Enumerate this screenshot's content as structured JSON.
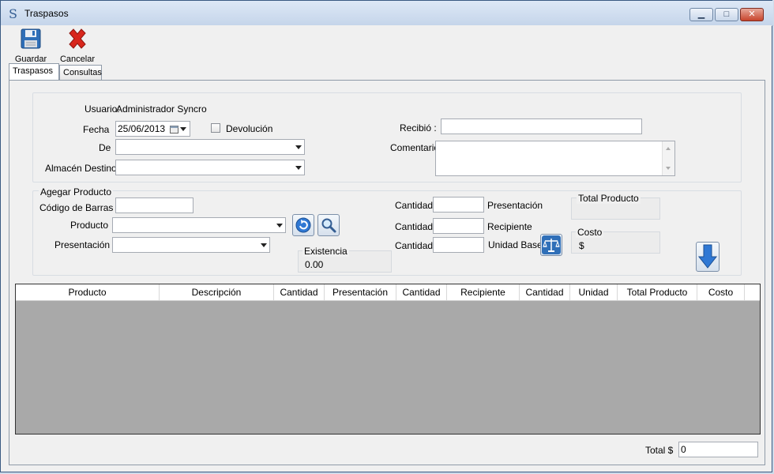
{
  "window": {
    "title": "Traspasos",
    "app_icon_glyph": "S",
    "minimize_glyph": "▁",
    "maximize_glyph": "□",
    "close_glyph": "✕"
  },
  "toolbar": {
    "save_label": "Guardar",
    "cancel_label": "Cancelar"
  },
  "tabs": [
    {
      "label": "Traspasos",
      "active": true
    },
    {
      "label": "Consultas",
      "active": false
    }
  ],
  "form": {
    "usuario_label": "Usuario:",
    "usuario_value": "Administrador Syncro",
    "fecha_label": "Fecha",
    "fecha_value": "25/06/2013",
    "devolucion_label": "Devolución",
    "de_label": "De",
    "de_value": "",
    "almacen_label": "Almacén Destino",
    "almacen_value": "",
    "recibio_label": "Recibió :",
    "recibio_value": "",
    "comentario_label": "Comentario",
    "comentario_value": ""
  },
  "product": {
    "group_title": "Agegar Producto",
    "barcode_label": "Código de Barras",
    "barcode_value": "",
    "producto_label": "Producto",
    "producto_value": "",
    "presentacion_label": "Presentación",
    "presentacion_value": "",
    "existencia_label": "Existencia",
    "existencia_value": "0.00",
    "cantidad_label": "Cantidad",
    "qty_presentacion_value": "",
    "qty_recipiente_value": "",
    "qty_unidad_value": "",
    "presentacion_unit": "Presentación",
    "recipiente_unit": "Recipiente",
    "unidad_unit": "Unidad Base",
    "total_producto_label": "Total Producto",
    "costo_label": "Costo",
    "costo_value": "$"
  },
  "grid": {
    "columns": [
      "Producto",
      "Descripción",
      "Cantidad",
      "Presentación",
      "Cantidad",
      "Recipiente",
      "Cantidad",
      "Unidad",
      "Total Producto",
      "Costo"
    ]
  },
  "footer": {
    "total_label": "Total $",
    "total_value": "0"
  },
  "colors": {
    "accent_blue": "#2f78d4",
    "cancel_red": "#d8261c",
    "grid_background": "#a9a9a9"
  }
}
